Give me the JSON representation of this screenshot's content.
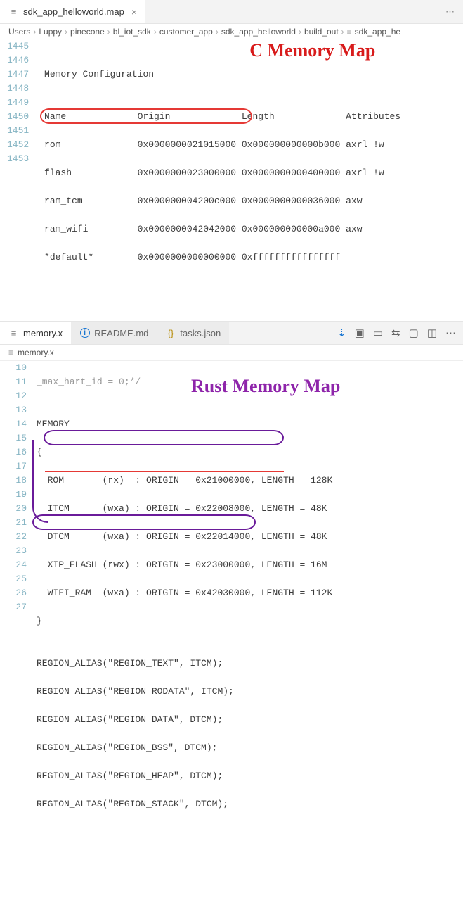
{
  "pane1": {
    "tab": {
      "filename": "sdk_app_helloworld.map"
    },
    "breadcrumbs": [
      "Users",
      "Luppy",
      "pinecone",
      "bl_iot_sdk",
      "customer_app",
      "sdk_app_helloworld",
      "build_out",
      "sdk_app_he"
    ],
    "title_overlay": "C Memory Map",
    "lines": [
      {
        "n": "1445",
        "t": ""
      },
      {
        "n": "1446",
        "t": " Memory Configuration"
      },
      {
        "n": "1447",
        "t": ""
      },
      {
        "n": "1448",
        "t": " Name             Origin             Length             Attributes"
      },
      {
        "n": "1449",
        "t": " rom              0x0000000021015000 0x000000000000b000 axrl !w"
      },
      {
        "n": "1450",
        "t": " flash            0x0000000023000000 0x0000000000400000 axrl !w"
      },
      {
        "n": "1451",
        "t": " ram_tcm          0x000000004200c000 0x0000000000036000 axw"
      },
      {
        "n": "1452",
        "t": " ram_wifi         0x0000000042042000 0x000000000000a000 axw"
      },
      {
        "n": "1453",
        "t": " *default*        0x0000000000000000 0xffffffffffffffff"
      }
    ]
  },
  "pane2": {
    "tabs": [
      {
        "label": "memory.x",
        "icon": "file",
        "active": true
      },
      {
        "label": "README.md",
        "icon": "info",
        "active": false
      },
      {
        "label": "tasks.json",
        "icon": "braces",
        "active": false
      }
    ],
    "subtab": "memory.x",
    "title_overlay": "Rust Memory Map",
    "lines": [
      {
        "n": "10",
        "t": "_max_hart_id = 0;*/"
      },
      {
        "n": "11",
        "t": ""
      },
      {
        "n": "12",
        "t": "MEMORY"
      },
      {
        "n": "13",
        "t": "{"
      },
      {
        "n": "14",
        "t": "  ROM       (rx)  : ORIGIN = 0x21000000, LENGTH = 128K"
      },
      {
        "n": "15",
        "t": "  ITCM      (wxa) : ORIGIN = 0x22008000, LENGTH = 48K"
      },
      {
        "n": "16",
        "t": "  DTCM      (wxa) : ORIGIN = 0x22014000, LENGTH = 48K"
      },
      {
        "n": "17",
        "t": "  XIP_FLASH (rwx) : ORIGIN = 0x23000000, LENGTH = 16M"
      },
      {
        "n": "18",
        "t": "  WIFI_RAM  (wxa) : ORIGIN = 0x42030000, LENGTH = 112K"
      },
      {
        "n": "19",
        "t": "}"
      },
      {
        "n": "20",
        "t": ""
      },
      {
        "n": "21",
        "t": "REGION_ALIAS(\"REGION_TEXT\", ITCM);"
      },
      {
        "n": "22",
        "t": "REGION_ALIAS(\"REGION_RODATA\", ITCM);"
      },
      {
        "n": "23",
        "t": "REGION_ALIAS(\"REGION_DATA\", DTCM);"
      },
      {
        "n": "24",
        "t": "REGION_ALIAS(\"REGION_BSS\", DTCM);"
      },
      {
        "n": "25",
        "t": "REGION_ALIAS(\"REGION_HEAP\", DTCM);"
      },
      {
        "n": "26",
        "t": "REGION_ALIAS(\"REGION_STACK\", DTCM);"
      },
      {
        "n": "27",
        "t": ""
      }
    ]
  },
  "toolbar_icons": [
    "arrow-down",
    "square-dot",
    "rect",
    "compare",
    "preview",
    "split",
    "more"
  ]
}
